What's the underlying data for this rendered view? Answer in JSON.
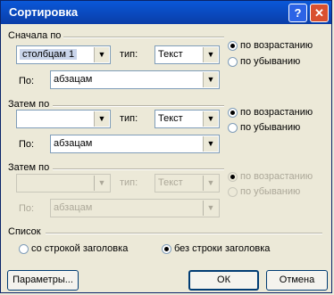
{
  "window": {
    "title": "Сортировка",
    "help_label": "?",
    "close_label": "✕"
  },
  "group1": {
    "legend": "Сначала по",
    "column_value": "столбцам 1",
    "type_label": "тип:",
    "type_value": "Текст",
    "asc_label": "по возрастанию",
    "desc_label": "по убыванию",
    "by_label": "По:",
    "by_value": "абзацам"
  },
  "group2": {
    "legend": "Затем по",
    "column_value": "",
    "type_label": "тип:",
    "type_value": "Текст",
    "asc_label": "по возрастанию",
    "desc_label": "по убыванию",
    "by_label": "По:",
    "by_value": "абзацам"
  },
  "group3": {
    "legend": "Затем по",
    "column_value": "",
    "type_label": "тип:",
    "type_value": "Текст",
    "asc_label": "по возрастанию",
    "desc_label": "по убыванию",
    "by_label": "По:",
    "by_value": "абзацам"
  },
  "list": {
    "legend": "Список",
    "with_header_label": "со строкой заголовка",
    "without_header_label": "без строки заголовка"
  },
  "buttons": {
    "params": "Параметры...",
    "ok": "ОК",
    "cancel": "Отмена"
  }
}
